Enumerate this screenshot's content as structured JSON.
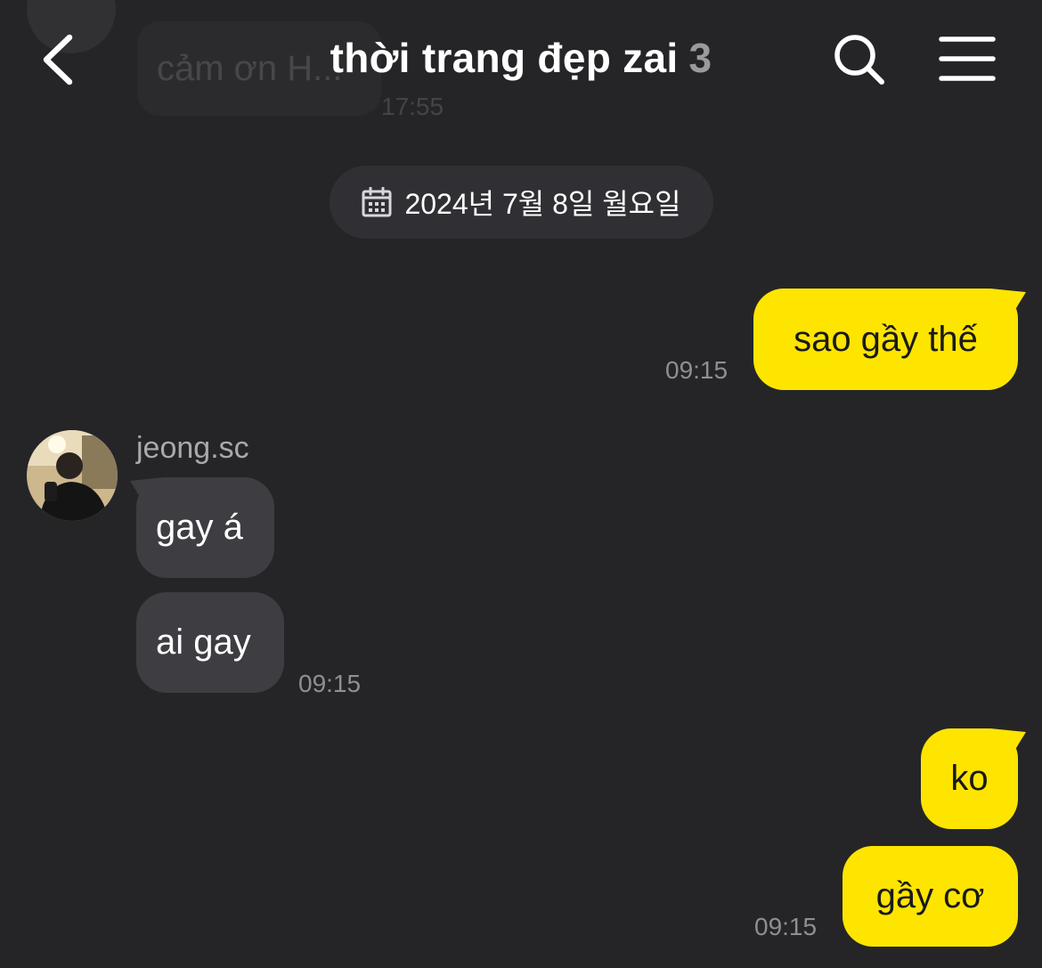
{
  "header": {
    "title": "thời trang đẹp zai",
    "member_count": "3"
  },
  "previous_message": {
    "text": "cảm ơn H...",
    "time": "17:55"
  },
  "date_divider": {
    "label": "2024년 7월 8일 월요일"
  },
  "messages": [
    {
      "from": "me",
      "text": "sao gầy thế",
      "time": "09:15"
    },
    {
      "from": "jeong.sc",
      "text": "gay á"
    },
    {
      "from": "jeong.sc",
      "text": "ai gay",
      "time": "09:15"
    },
    {
      "from": "me",
      "text": "ko"
    },
    {
      "from": "me",
      "text": "gầy cơ",
      "time": "09:15"
    }
  ],
  "other_user": {
    "name": "jeong.sc"
  },
  "colors": {
    "background": "#252528",
    "my_bubble": "#fee500",
    "their_bubble": "#3d3d42",
    "timestamp": "#8e8e93"
  },
  "icons": {
    "back": "chevron-left-icon",
    "search": "search-icon",
    "menu": "hamburger-menu-icon",
    "date": "calendar-icon"
  }
}
